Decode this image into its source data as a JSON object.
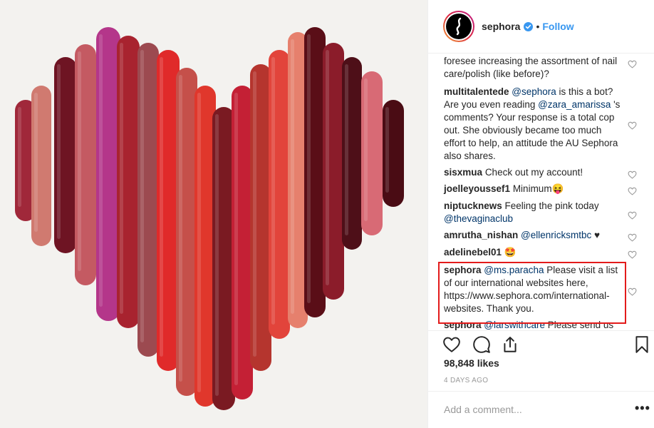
{
  "post": {
    "username": "sephora",
    "follow_label": "Follow",
    "separator": "•"
  },
  "comments": [
    {
      "user": "",
      "parts": [
        {
          "t": "text",
          "v": "foresee increasing the assortment of nail care/polish (like before)?"
        }
      ]
    },
    {
      "user": "multitalentede",
      "parts": [
        {
          "t": "mention",
          "v": "@sephora"
        },
        {
          "t": "text",
          "v": " is this a bot? Are you even reading "
        },
        {
          "t": "mention",
          "v": "@zara_amarissa"
        },
        {
          "t": "text",
          "v": " 's comments? Your response is a total cop out. She obviously became too much effort to help, an attitude the AU Sephora also shares."
        }
      ]
    },
    {
      "user": "sisxmua",
      "parts": [
        {
          "t": "text",
          "v": "Check out my account!"
        }
      ]
    },
    {
      "user": "joelleyoussef1",
      "parts": [
        {
          "t": "text",
          "v": "Minimum😝"
        }
      ]
    },
    {
      "user": "niptucknews",
      "parts": [
        {
          "t": "text",
          "v": "Feeling the pink today "
        },
        {
          "t": "mention",
          "v": "@thevaginaclub"
        }
      ]
    },
    {
      "user": "amrutha_nishan",
      "parts": [
        {
          "t": "mention",
          "v": "@ellenricksmtbc"
        },
        {
          "t": "text",
          "v": " ♥"
        }
      ]
    },
    {
      "user": "adelinebel01",
      "parts": [
        {
          "t": "text",
          "v": "🤩"
        }
      ]
    },
    {
      "user": "sephora",
      "parts": [
        {
          "t": "mention",
          "v": "@ms.paracha"
        },
        {
          "t": "text",
          "v": " Please visit a list of our international websites here, https://www.sephora.com/international-websites. Thank you."
        }
      ]
    },
    {
      "user": "sephora",
      "parts": [
        {
          "t": "mention",
          "v": "@larswithcare"
        },
        {
          "t": "text",
          "v": " Please send us"
        }
      ]
    }
  ],
  "likes": "98,848 likes",
  "date": "4 DAYS AGO",
  "add_comment": {
    "placeholder": "Add a comment..."
  },
  "more_label": "•••",
  "colors": {
    "accent": "#3897f0",
    "highlight": "#e31b1b",
    "mention": "#003569"
  },
  "icons": [
    "heart-icon",
    "comment-icon",
    "share-icon",
    "bookmark-icon",
    "verified-badge-icon",
    "more-options-icon"
  ]
}
